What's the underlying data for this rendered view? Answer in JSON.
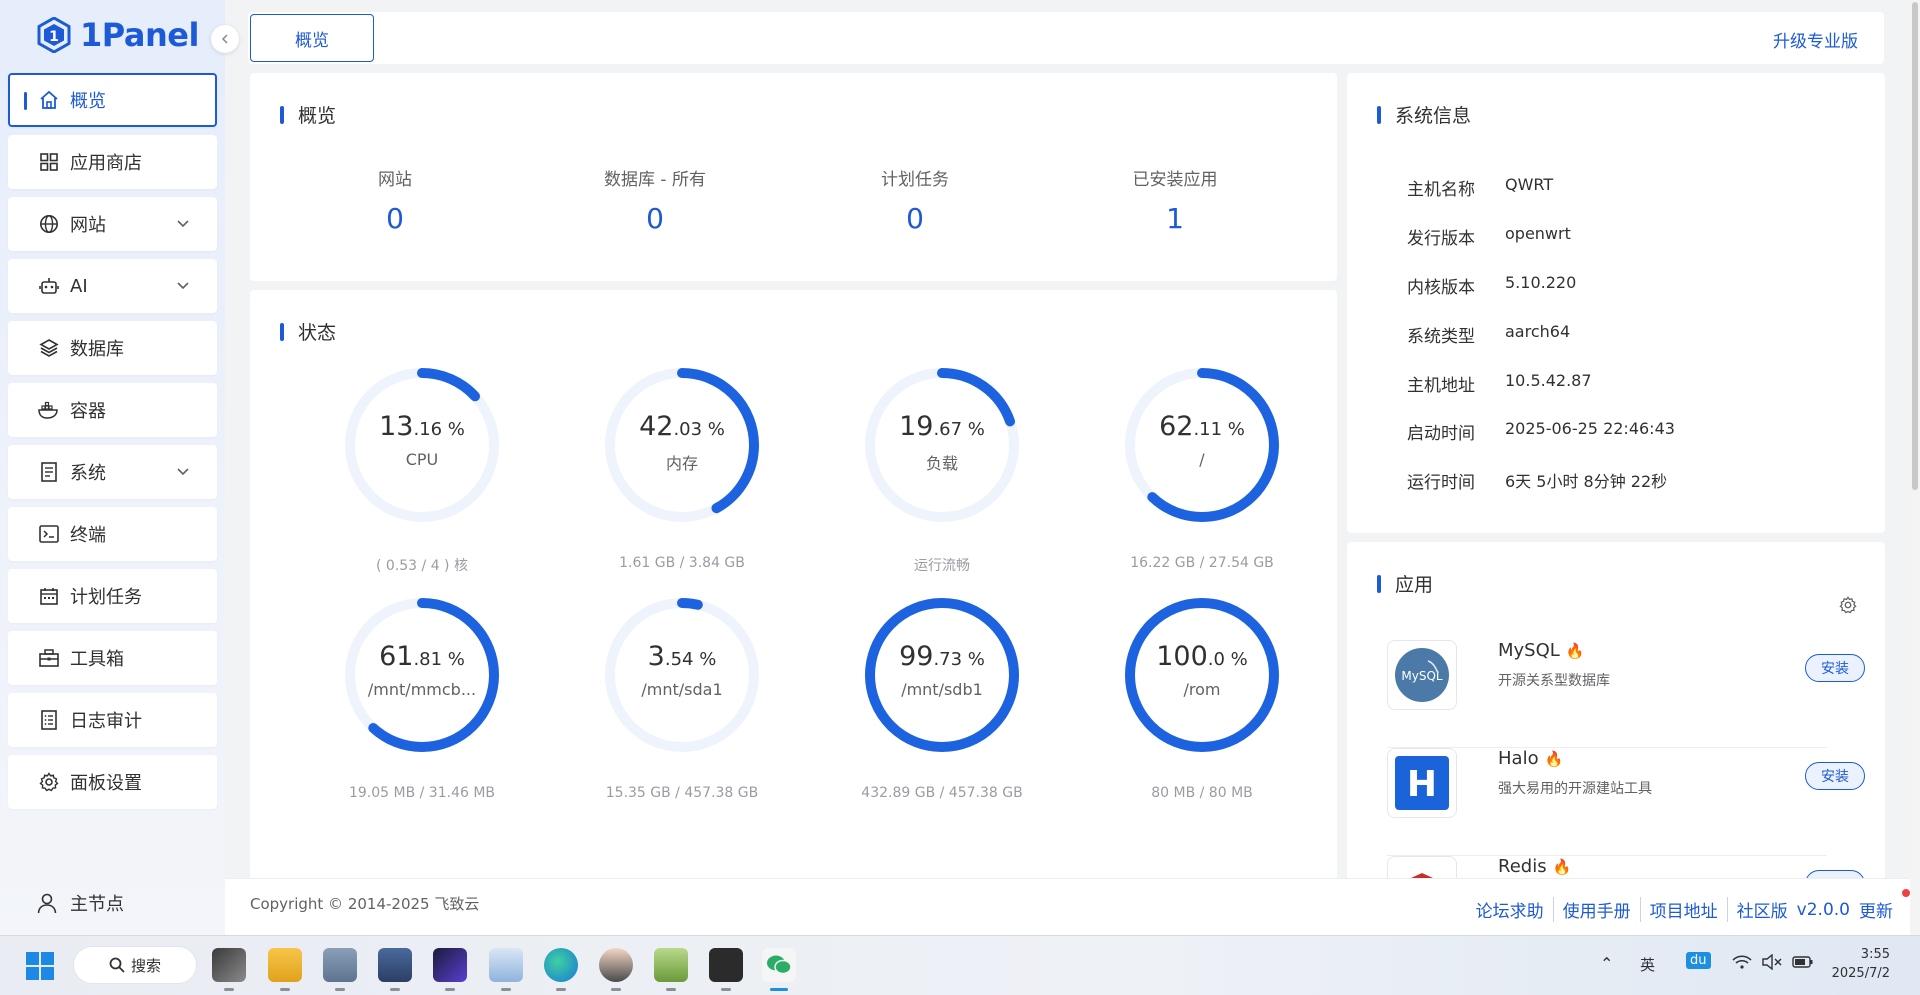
{
  "app": {
    "logo_text": "1Panel"
  },
  "sidebar": {
    "items": [
      {
        "label": "概览",
        "icon": "home-icon"
      },
      {
        "label": "应用商店",
        "icon": "grid-icon"
      },
      {
        "label": "网站",
        "icon": "globe-icon"
      },
      {
        "label": "AI",
        "icon": "robot-icon"
      },
      {
        "label": "数据库",
        "icon": "layers-icon"
      },
      {
        "label": "容器",
        "icon": "docker-icon"
      },
      {
        "label": "系统",
        "icon": "file-icon"
      },
      {
        "label": "终端",
        "icon": "terminal-icon"
      },
      {
        "label": "计划任务",
        "icon": "calendar-icon"
      },
      {
        "label": "工具箱",
        "icon": "toolbox-icon"
      },
      {
        "label": "日志审计",
        "icon": "log-icon"
      },
      {
        "label": "面板设置",
        "icon": "gear-icon"
      }
    ],
    "footer_label": "主节点"
  },
  "topbar": {
    "tab_label": "概览",
    "upgrade_label": "升级专业版"
  },
  "overview": {
    "title": "概览",
    "stats": [
      {
        "label": "网站",
        "value": "0"
      },
      {
        "label": "数据库 - 所有",
        "value": "0"
      },
      {
        "label": "计划任务",
        "value": "0"
      },
      {
        "label": "已安装应用",
        "value": "1"
      }
    ]
  },
  "status": {
    "title": "状态",
    "gauges": [
      {
        "int": "13",
        "dec": ".16",
        "unit": " %",
        "name": "CPU",
        "percent": 13.16,
        "foot": "( 0.53 / 4 ) 核"
      },
      {
        "int": "42",
        "dec": ".03",
        "unit": " %",
        "name": "内存",
        "percent": 42.03,
        "foot": "1.61 GB / 3.84 GB"
      },
      {
        "int": "19",
        "dec": ".67",
        "unit": " %",
        "name": "负载",
        "percent": 19.67,
        "foot": "运行流畅"
      },
      {
        "int": "62",
        "dec": ".11",
        "unit": " %",
        "name": "/",
        "percent": 62.11,
        "foot": "16.22 GB / 27.54 GB"
      },
      {
        "int": "61",
        "dec": ".81",
        "unit": " %",
        "name": "/mnt/mmcb...",
        "percent": 61.81,
        "foot": "19.05 MB / 31.46 MB"
      },
      {
        "int": "3",
        "dec": ".54",
        "unit": " %",
        "name": "/mnt/sda1",
        "percent": 3.54,
        "foot": "15.35 GB / 457.38 GB"
      },
      {
        "int": "99",
        "dec": ".73",
        "unit": " %",
        "name": "/mnt/sdb1",
        "percent": 99.73,
        "foot": "432.89 GB / 457.38 GB"
      },
      {
        "int": "100",
        "dec": ".0",
        "unit": " %",
        "name": "/rom",
        "percent": 100.0,
        "foot": "80 MB / 80 MB"
      }
    ]
  },
  "sysinfo": {
    "title": "系统信息",
    "rows": [
      {
        "key": "主机名称",
        "value": "QWRT"
      },
      {
        "key": "发行版本",
        "value": "openwrt"
      },
      {
        "key": "内核版本",
        "value": "5.10.220"
      },
      {
        "key": "系统类型",
        "value": "aarch64"
      },
      {
        "key": "主机地址",
        "value": "10.5.42.87"
      },
      {
        "key": "启动时间",
        "value": "2025-06-25 22:46:43"
      },
      {
        "key": "运行时间",
        "value": "6天 5小时 8分钟 22秒"
      }
    ]
  },
  "apps": {
    "title": "应用",
    "items": [
      {
        "name": "MySQL",
        "desc": "开源关系型数据库",
        "button": "安装",
        "logo_text": "MySQL"
      },
      {
        "name": "Halo",
        "desc": "强大易用的开源建站工具",
        "button": "安装",
        "logo_text": "H"
      },
      {
        "name": "Redis",
        "desc": "",
        "button": "",
        "logo_text": ""
      }
    ]
  },
  "footer": {
    "copyright": "Copyright © 2014-2025 飞致云",
    "links": [
      "论坛求助",
      "使用手册",
      "项目地址",
      "社区版",
      "v2.0.0",
      "更新"
    ]
  },
  "taskbar": {
    "search_label": "搜索",
    "tray_ime": "英",
    "tray_du": "du",
    "time": "3:55",
    "date": "2025/7/2"
  },
  "colors": {
    "accent": "#1d5ad8",
    "gauge_track": "#eef3fc",
    "gauge_arc": "#1d63e0"
  }
}
